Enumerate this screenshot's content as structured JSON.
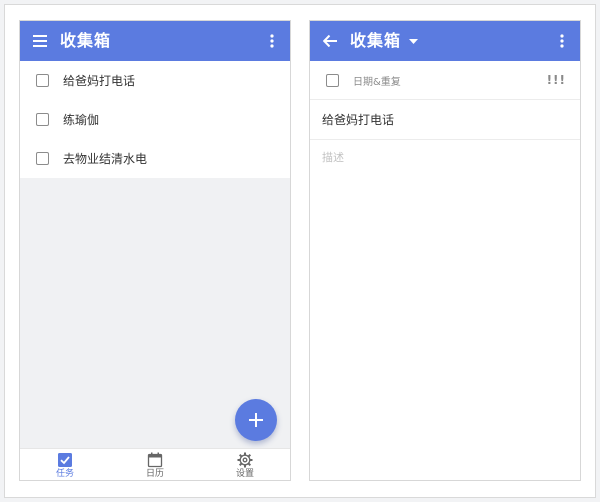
{
  "colors": {
    "accent": "#5b7be0",
    "empty_bg": "#f0f1f3",
    "text": "#333333",
    "muted": "#8a8a8a"
  },
  "left": {
    "appbar": {
      "title": "收集箱",
      "menu_icon": "hamburger-icon",
      "more_icon": "more-vertical-icon"
    },
    "tasks": [
      {
        "text": "给爸妈打电话"
      },
      {
        "text": "练瑜伽"
      },
      {
        "text": "去物业结清水电"
      }
    ],
    "fab_icon": "plus-icon",
    "bottom_nav": [
      {
        "label": "任务",
        "icon": "checkbox-checked-icon",
        "active": true
      },
      {
        "label": "日历",
        "icon": "calendar-icon",
        "active": false
      },
      {
        "label": "设置",
        "icon": "gear-icon",
        "active": false
      }
    ]
  },
  "right": {
    "appbar": {
      "title": "收集箱",
      "back_icon": "arrow-left-icon",
      "caret_icon": "caret-down-icon",
      "more_icon": "more-vertical-icon"
    },
    "date_repeat_label": "日期&重复",
    "priority_label": "!!!",
    "task_title": "给爸妈打电话",
    "description_placeholder": "描述"
  }
}
